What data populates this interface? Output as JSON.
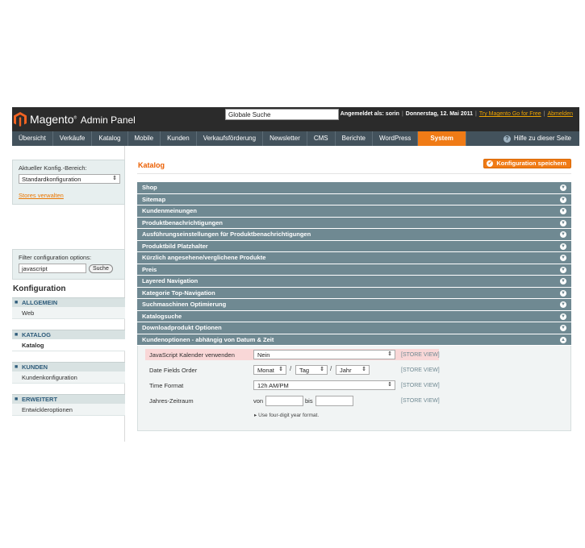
{
  "header": {
    "logo_brand": "Magento",
    "logo_suffix": "Admin Panel",
    "search_value": "Globale Suche",
    "logged_in": "Angemeldet als: sorin",
    "date": "Donnerstag, 12. Mai 2011",
    "try_link": "Try Magento Go for Free",
    "logout": "Abmelden"
  },
  "nav": {
    "items": [
      "Übersicht",
      "Verkäufe",
      "Katalog",
      "Mobile",
      "Kunden",
      "Verkaufsförderung",
      "Newsletter",
      "CMS",
      "Berichte",
      "WordPress",
      "System"
    ],
    "active": "System",
    "help": "Hilfe zu dieser Seite"
  },
  "sidebar": {
    "scope_label": "Aktueller Konfig.-Bereich:",
    "scope_value": "Standardkonfiguration",
    "stores_link": "Stores verwalten",
    "filter_label": "Filter configuration options:",
    "filter_value": "javascript",
    "filter_button": "Suche",
    "title": "Konfiguration",
    "sections": [
      {
        "head": "ALLGEMEIN",
        "items": [
          "Web"
        ]
      },
      {
        "head": "KATALOG",
        "items": [
          "Katalog"
        ]
      },
      {
        "head": "KUNDEN",
        "items": [
          "Kundenkonfiguration"
        ]
      },
      {
        "head": "ERWEITERT",
        "items": [
          "Entwickleroptionen"
        ]
      }
    ]
  },
  "main": {
    "title": "Katalog",
    "save_button": "Konfiguration speichern",
    "groups": [
      "Shop",
      "Sitemap",
      "Kundenmeinungen",
      "Produktbenachrichtigungen",
      "Ausführungseinstellungen für Produktbenachrichtigungen",
      "Produktbild Platzhalter",
      "Kürzlich angesehene/verglichene Produkte",
      "Preis",
      "Layered Navigation",
      "Kategorie Top-Navigation",
      "Suchmaschinen Optimierung",
      "Katalogsuche",
      "Downloadprodukt Optionen",
      "Kundenoptionen - abhängig von Datum & Zeit"
    ],
    "fields": {
      "js_calendar_label": "JavaScript Kalender verwenden",
      "js_calendar_value": "Nein",
      "date_order_label": "Date Fields Order",
      "date_month": "Monat",
      "date_day": "Tag",
      "date_year": "Jahr",
      "time_format_label": "Time Format",
      "time_format_value": "12h AM/PM",
      "year_range_label": "Jahres-Zeitraum",
      "from_label": "von",
      "to_label": "bis",
      "year_note": "Use four-digit year format.",
      "scope_tag": "[STORE VIEW]"
    }
  },
  "colors": {
    "header_bg": "#2b2b2b",
    "nav_bg": "#43525c",
    "accent": "#f07b16",
    "group_bg": "#6f8992",
    "highlight": "#f9d7d7"
  }
}
